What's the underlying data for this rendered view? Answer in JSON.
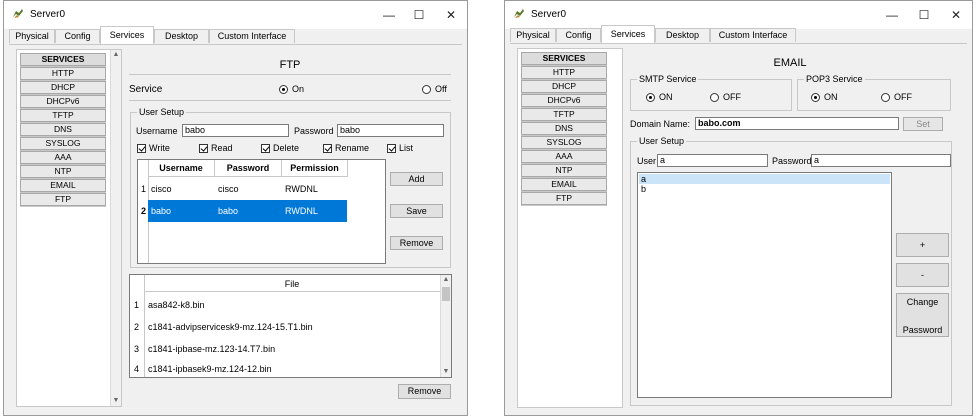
{
  "ftp_window": {
    "title": "Server0",
    "tabs": [
      "Physical",
      "Config",
      "Services",
      "Desktop",
      "Custom Interface"
    ],
    "active_tab": "Services",
    "sidebar": [
      "SERVICES",
      "HTTP",
      "DHCP",
      "DHCPv6",
      "TFTP",
      "DNS",
      "SYSLOG",
      "AAA",
      "NTP",
      "EMAIL",
      "FTP"
    ],
    "panel_title": "FTP",
    "service_label": "Service",
    "on_label": "On",
    "off_label": "Off",
    "user_setup_label": "User Setup",
    "username_label": "Username",
    "username_value": "babo",
    "password_label": "Password",
    "password_value": "babo",
    "permissions": [
      "Write",
      "Read",
      "Delete",
      "Rename",
      "List"
    ],
    "columns": [
      "Username",
      "Password",
      "Permission"
    ],
    "users": [
      {
        "num": "1",
        "username": "cisco",
        "password": "cisco",
        "permission": "RWDNL"
      },
      {
        "num": "2",
        "username": "babo",
        "password": "babo",
        "permission": "RWDNL"
      }
    ],
    "add_label": "Add",
    "save_label": "Save",
    "remove_label": "Remove",
    "file_header": "File",
    "files": [
      {
        "num": "1",
        "name": "asa842-k8.bin"
      },
      {
        "num": "2",
        "name": "c1841-advipservicesk9-mz.124-15.T1.bin"
      },
      {
        "num": "3",
        "name": "c1841-ipbase-mz.123-14.T7.bin"
      },
      {
        "num": "4",
        "name": "c1841-ipbasek9-mz.124-12.bin"
      }
    ],
    "file_remove_label": "Remove"
  },
  "email_window": {
    "title": "Server0",
    "tabs": [
      "Physical",
      "Config",
      "Services",
      "Desktop",
      "Custom Interface"
    ],
    "active_tab": "Services",
    "sidebar": [
      "SERVICES",
      "HTTP",
      "DHCP",
      "DHCPv6",
      "TFTP",
      "DNS",
      "SYSLOG",
      "AAA",
      "NTP",
      "EMAIL",
      "FTP"
    ],
    "panel_title": "EMAIL",
    "smtp_label": "SMTP Service",
    "pop3_label": "POP3 Service",
    "on_label": "ON",
    "off_label": "OFF",
    "domain_label": "Domain Name:",
    "domain_value": "babo.com",
    "set_label": "Set",
    "user_setup_label": "User Setup",
    "user_label": "User",
    "user_value": "a",
    "password_label": "Password",
    "password_value": "a",
    "users": [
      "a",
      "b"
    ],
    "plus_label": "+",
    "minus_label": "-",
    "change_label": "Change",
    "password_btn_label": "Password"
  },
  "icons": {
    "app": "server-icon",
    "minimize": "minimize-icon",
    "maximize": "maximize-icon",
    "close": "close-icon"
  },
  "colors": {
    "selection": "#0078d7",
    "window_bg": "#f0f0f0",
    "title_bg": "#ffffff"
  }
}
